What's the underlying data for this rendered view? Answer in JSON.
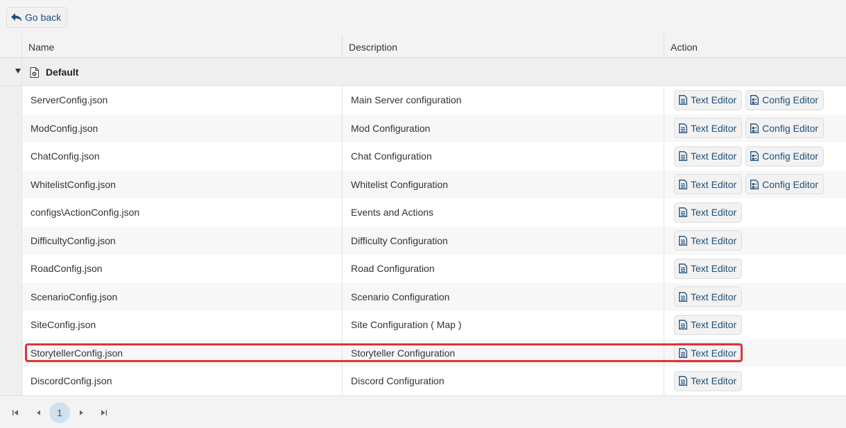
{
  "back_label": "Go back",
  "columns": [
    "Name",
    "Description",
    "Action"
  ],
  "group": {
    "name": "Default",
    "expanded": true
  },
  "buttons": {
    "text_editor": "Text Editor",
    "config_editor": "Config Editor"
  },
  "rows": [
    {
      "name": "ServerConfig.json",
      "description": "Main Server configuration",
      "config_editor": true
    },
    {
      "name": "ModConfig.json",
      "description": "Mod Configuration",
      "config_editor": true
    },
    {
      "name": "ChatConfig.json",
      "description": "Chat Configuration",
      "config_editor": true
    },
    {
      "name": "WhitelistConfig.json",
      "description": "Whitelist Configuration",
      "config_editor": true
    },
    {
      "name": "configs\\ActionConfig.json",
      "description": "Events and Actions",
      "config_editor": false
    },
    {
      "name": "DifficultyConfig.json",
      "description": "Difficulty Configuration",
      "config_editor": false
    },
    {
      "name": "RoadConfig.json",
      "description": "Road Configuration",
      "config_editor": false
    },
    {
      "name": "ScenarioConfig.json",
      "description": "Scenario Configuration",
      "config_editor": false
    },
    {
      "name": "SiteConfig.json",
      "description": "Site Configuration ( Map )",
      "config_editor": false
    },
    {
      "name": "StorytellerConfig.json",
      "description": "Storyteller Configuration",
      "config_editor": false,
      "highlighted": true
    },
    {
      "name": "DiscordConfig.json",
      "description": "Discord Configuration",
      "config_editor": false
    }
  ],
  "pagination": {
    "current_page": "1"
  },
  "colors": {
    "accent": "#1f4e79",
    "highlight": "#e0323a",
    "page_active": "#cfe1ec"
  }
}
